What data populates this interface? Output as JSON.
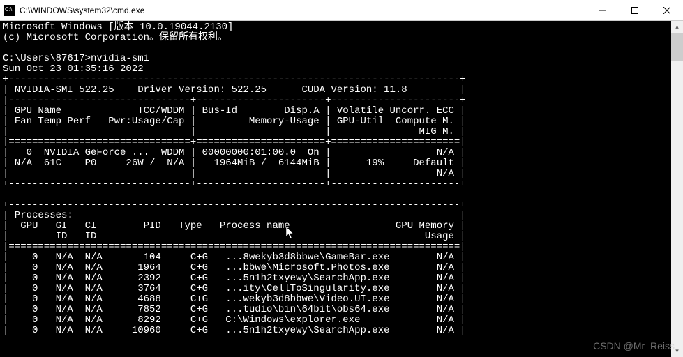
{
  "titlebar": {
    "title": "C:\\WINDOWS\\system32\\cmd.exe"
  },
  "header": {
    "line1": "Microsoft Windows [版本 10.0.19044.2130]",
    "line2": "(c) Microsoft Corporation。保留所有权利。"
  },
  "prompt": {
    "path": "C:\\Users\\87617>",
    "command": "nvidia-smi"
  },
  "timestamp": "Sun Oct 23 01:35:16 2022",
  "smi": {
    "version": "NVIDIA-SMI 522.25",
    "driver": "Driver Version: 522.25",
    "cuda": "CUDA Version: 11.8",
    "hdr": {
      "gpu": "GPU",
      "name": "Name",
      "tcc": "TCC/WDDM",
      "bus": "Bus-Id",
      "disp": "Disp.A",
      "vol": "Volatile Uncorr. ECC",
      "fan": "Fan",
      "temp": "Temp",
      "perf": "Perf",
      "pwr": "Pwr:Usage/Cap",
      "mem": "Memory-Usage",
      "util": "GPU-Util",
      "comp": "Compute M.",
      "mig": "MIG M."
    },
    "row": {
      "idx": "0",
      "name": "NVIDIA GeForce ...",
      "mode": "WDDM",
      "bus": "00000000:01:00.0",
      "disp": "On",
      "ecc": "N/A",
      "fan": "N/A",
      "temp": "61C",
      "perf": "P0",
      "pwr": "26W /  N/A",
      "mem": "1964MiB /  6144MiB",
      "util": "19%",
      "comp": "Default",
      "mig": "N/A"
    }
  },
  "proc": {
    "title": "Processes:",
    "hdr": {
      "gpu": "GPU",
      "gi": "GI",
      "ci": "CI",
      "pid": "PID",
      "type": "Type",
      "name": "Process name",
      "mem": "GPU Memory",
      "id1": "ID",
      "id2": "ID",
      "usage": "Usage"
    },
    "rows": [
      {
        "gpu": "0",
        "gi": "N/A",
        "ci": "N/A",
        "pid": "104",
        "type": "C+G",
        "name": "...8wekyb3d8bbwe\\GameBar.exe",
        "mem": "N/A"
      },
      {
        "gpu": "0",
        "gi": "N/A",
        "ci": "N/A",
        "pid": "1964",
        "type": "C+G",
        "name": "...bbwe\\Microsoft.Photos.exe",
        "mem": "N/A"
      },
      {
        "gpu": "0",
        "gi": "N/A",
        "ci": "N/A",
        "pid": "2392",
        "type": "C+G",
        "name": "...5n1h2txyewy\\SearchApp.exe",
        "mem": "N/A"
      },
      {
        "gpu": "0",
        "gi": "N/A",
        "ci": "N/A",
        "pid": "3764",
        "type": "C+G",
        "name": "...ity\\CellToSingularity.exe",
        "mem": "N/A"
      },
      {
        "gpu": "0",
        "gi": "N/A",
        "ci": "N/A",
        "pid": "4688",
        "type": "C+G",
        "name": "...wekyb3d8bbwe\\Video.UI.exe",
        "mem": "N/A"
      },
      {
        "gpu": "0",
        "gi": "N/A",
        "ci": "N/A",
        "pid": "7852",
        "type": "C+G",
        "name": "...tudio\\bin\\64bit\\obs64.exe",
        "mem": "N/A"
      },
      {
        "gpu": "0",
        "gi": "N/A",
        "ci": "N/A",
        "pid": "8292",
        "type": "C+G",
        "name": "C:\\Windows\\explorer.exe",
        "mem": "N/A"
      },
      {
        "gpu": "0",
        "gi": "N/A",
        "ci": "N/A",
        "pid": "10960",
        "type": "C+G",
        "name": "...5n1h2txyewy\\SearchApp.exe",
        "mem": "N/A"
      }
    ]
  },
  "watermark": "CSDN @Mr_Reiss"
}
